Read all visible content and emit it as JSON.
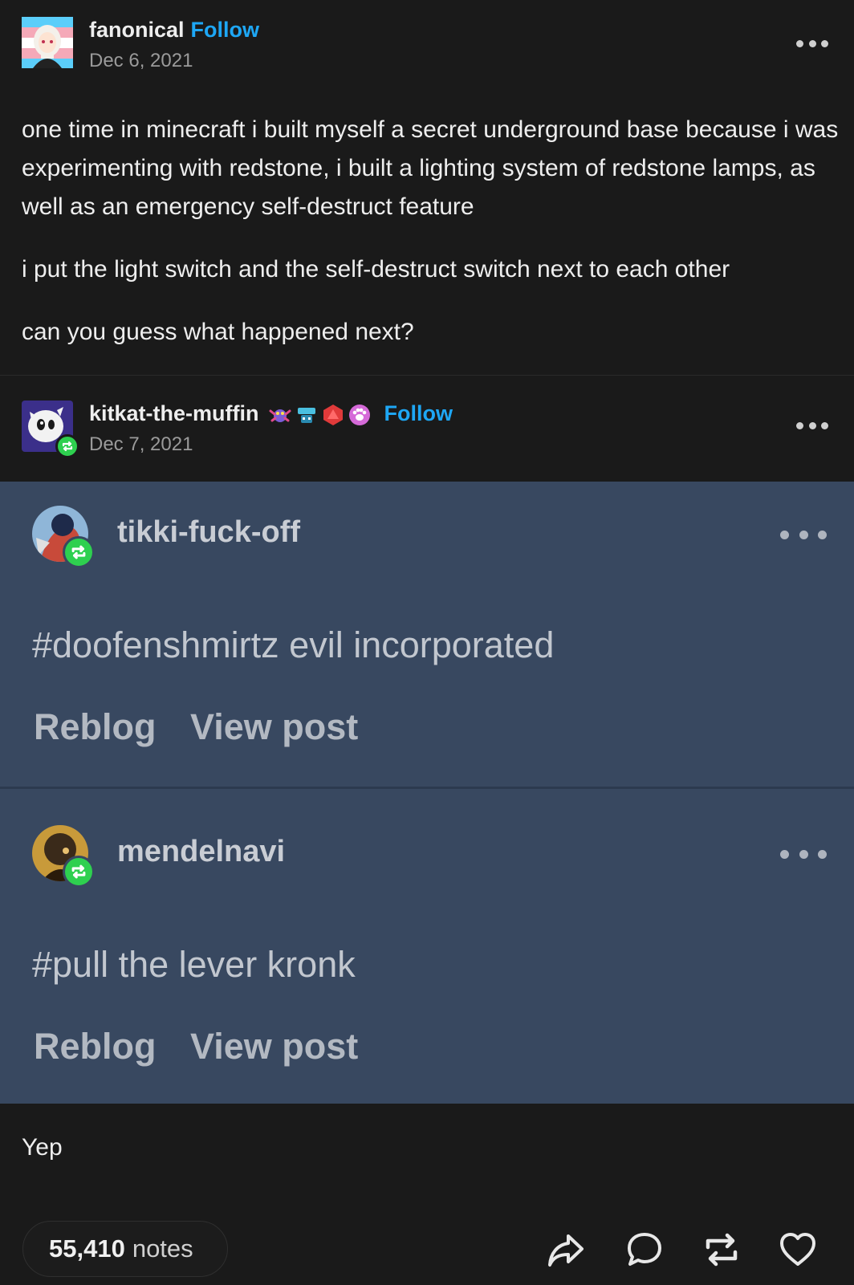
{
  "original_post": {
    "username": "fanonical",
    "follow_label": "Follow",
    "date": "Dec 6, 2021",
    "paragraphs": [
      "one time in minecraft i built myself a secret underground base because i was experimenting with redstone, i built a lighting system of redstone lamps, as well as an emergency self-destruct feature",
      "i put the light switch and the self-destruct switch next to each other",
      "can you guess what happened next?"
    ]
  },
  "reblog_post": {
    "username": "kitkat-the-muffin",
    "follow_label": "Follow",
    "date": "Dec 7, 2021",
    "badge_icons": [
      "crab-badge-icon",
      "robot-badge-icon",
      "d20-badge-icon",
      "paw-badge-icon"
    ]
  },
  "embedded_reblogs": [
    {
      "username": "tikki-fuck-off",
      "tag": "#doofenshmirtz evil incorporated",
      "reblog_label": "Reblog",
      "view_post_label": "View post"
    },
    {
      "username": "mendelnavi",
      "tag": "#pull the lever kronk",
      "reblog_label": "Reblog",
      "view_post_label": "View post"
    }
  ],
  "reply_text": "Yep",
  "footer": {
    "notes_count": "55,410",
    "notes_label": "notes",
    "actions": [
      "share-icon",
      "comment-icon",
      "reblog-icon",
      "like-icon"
    ]
  },
  "colors": {
    "background": "#1a1a1a",
    "accent_blue": "#1ea7f5",
    "reblog_green": "#2ed04f",
    "panel_blue": "#384860"
  }
}
